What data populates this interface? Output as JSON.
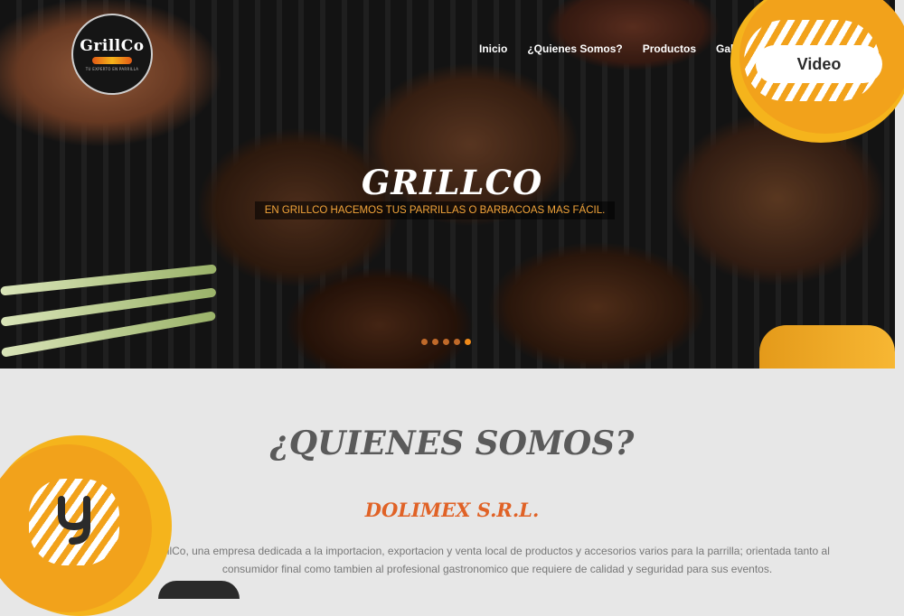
{
  "brand": {
    "logo_text": "GrillCo",
    "logo_tagline": "TU EXPERTO EN PARRILLA"
  },
  "nav": {
    "items": [
      {
        "label": "Inicio"
      },
      {
        "label": "¿Quienes Somos?"
      },
      {
        "label": "Productos"
      },
      {
        "label": "Galeria"
      }
    ]
  },
  "hero": {
    "title": "GRILLCO",
    "subtitle": "EN GRILLCO HACEMOS TUS PARRILLAS O BARBACOAS MAS FÁCIL.",
    "slides": 5,
    "active_slide": 5
  },
  "video_badge": {
    "label": "Video"
  },
  "about": {
    "title": "¿QUIENES SOMOS?",
    "company": "DOLIMEX S.R.L.",
    "description": "illCo, una empresa dedicada a la importacion, exportacion y venta local de productos y accesorios varios para la parrilla; orientada tanto al consumidor final como tambien al profesional gastronomico que requiere de calidad y seguridad para sus eventos."
  },
  "colors": {
    "accent": "#f2a21b",
    "company": "#e06226",
    "hero_subtitle": "#f3a53a",
    "page_bg": "#e7e7e7"
  }
}
